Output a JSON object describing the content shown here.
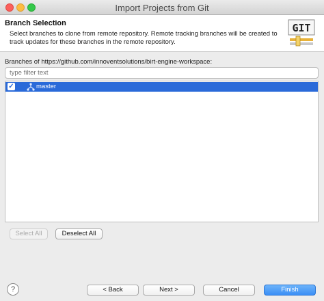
{
  "window": {
    "title": "Import Projects from Git"
  },
  "header": {
    "title": "Branch Selection",
    "description": "Select branches to clone from remote repository. Remote tracking branches will be created to track updates for these branches in the remote repository.",
    "logo_text": "GIT"
  },
  "branches": {
    "label": "Branches of https://github.com/innoventsolutions/birt-engine-workspace:",
    "filter_placeholder": "type filter text",
    "items": [
      {
        "name": "master",
        "checked": true,
        "selected": true
      }
    ]
  },
  "selection_buttons": {
    "select_all": "Select All",
    "deselect_all": "Deselect All"
  },
  "footer": {
    "back": "< Back",
    "next": "Next >",
    "cancel": "Cancel",
    "finish": "Finish",
    "help": "?"
  }
}
